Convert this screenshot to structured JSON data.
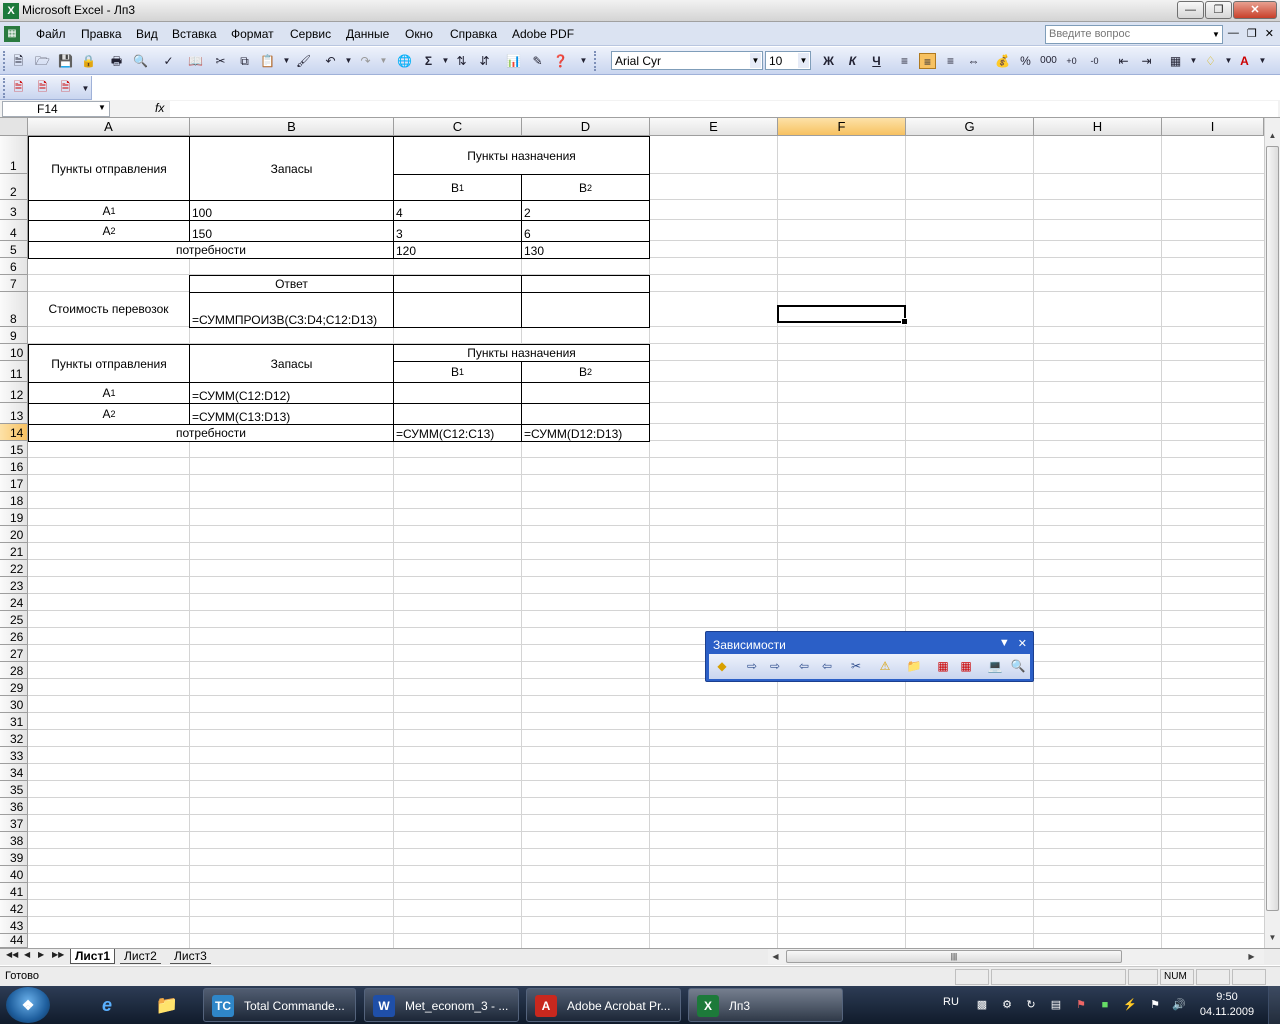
{
  "window": {
    "title": "Microsoft Excel - Лп3",
    "app_icon": "X"
  },
  "menu": {
    "items": [
      "Файл",
      "Правка",
      "Вид",
      "Вставка",
      "Формат",
      "Сервис",
      "Данные",
      "Окно",
      "Справка",
      "Adobe PDF"
    ],
    "ask_placeholder": "Введите вопрос"
  },
  "toolbar": {
    "font": "Arial Cyr",
    "size": "10",
    "bold": "Ж",
    "italic": "К",
    "underline": "Ч"
  },
  "formula_bar": {
    "name_box": "F14",
    "fx": "fx",
    "value": ""
  },
  "columns": [
    "A",
    "B",
    "C",
    "D",
    "E",
    "F",
    "G",
    "H",
    "I"
  ],
  "rows": [
    "1",
    "2",
    "3",
    "4",
    "5",
    "6",
    "7",
    "8",
    "9",
    "10",
    "11",
    "12",
    "13",
    "14",
    "15",
    "16",
    "17",
    "18",
    "19",
    "20",
    "21",
    "22",
    "23",
    "24",
    "25",
    "26",
    "27",
    "28",
    "29",
    "30",
    "31",
    "32",
    "33",
    "34",
    "35",
    "36",
    "37",
    "38",
    "39",
    "40",
    "41",
    "42",
    "43",
    "44"
  ],
  "cells": {
    "a1": "Пункты отправления",
    "b1": "Запасы",
    "c1": "Пункты назначения",
    "c2_main": "B",
    "c2_sub": "1",
    "d2_main": "B",
    "d2_sub": "2",
    "a3_main": "A",
    "a3_sub": "1",
    "b3": "100",
    "c3": "4",
    "d3": "2",
    "a4_main": "A",
    "a4_sub": "2",
    "b4": "150",
    "c4": "3",
    "d4": "6",
    "a5": "потребности",
    "c5": "120",
    "d5": "130",
    "b7": "Ответ",
    "a8": "Стоимость перевозок",
    "b8": "=СУММПРОИЗВ(C3:D4;C12:D13)",
    "a10": "Пункты отправления",
    "b10": "Запасы",
    "c10": "Пункты назначения",
    "c11_main": "B",
    "c11_sub": "1",
    "d11_main": "B",
    "d11_sub": "2",
    "a12_main": "A",
    "a12_sub": "1",
    "b12": "=СУММ(C12:D12)",
    "a13_main": "A",
    "a13_sub": "2",
    "b13": "=СУММ(C13:D13)",
    "a14": "потребности",
    "c14": "=СУММ(C12:C13)",
    "d14": "=СУММ(D12:D13)"
  },
  "sheets": [
    "Лист1",
    "Лист2",
    "Лист3"
  ],
  "status": {
    "ready": "Готово",
    "num": "NUM"
  },
  "float_toolbar": {
    "title": "Зависимости"
  },
  "taskbar": {
    "items": [
      "Total Commande...",
      "Met_econom_3 - ...",
      "Adobe Acrobat Pr...",
      "Лп3"
    ],
    "lang": "RU",
    "time": "9:50",
    "date": "04.11.2009"
  }
}
